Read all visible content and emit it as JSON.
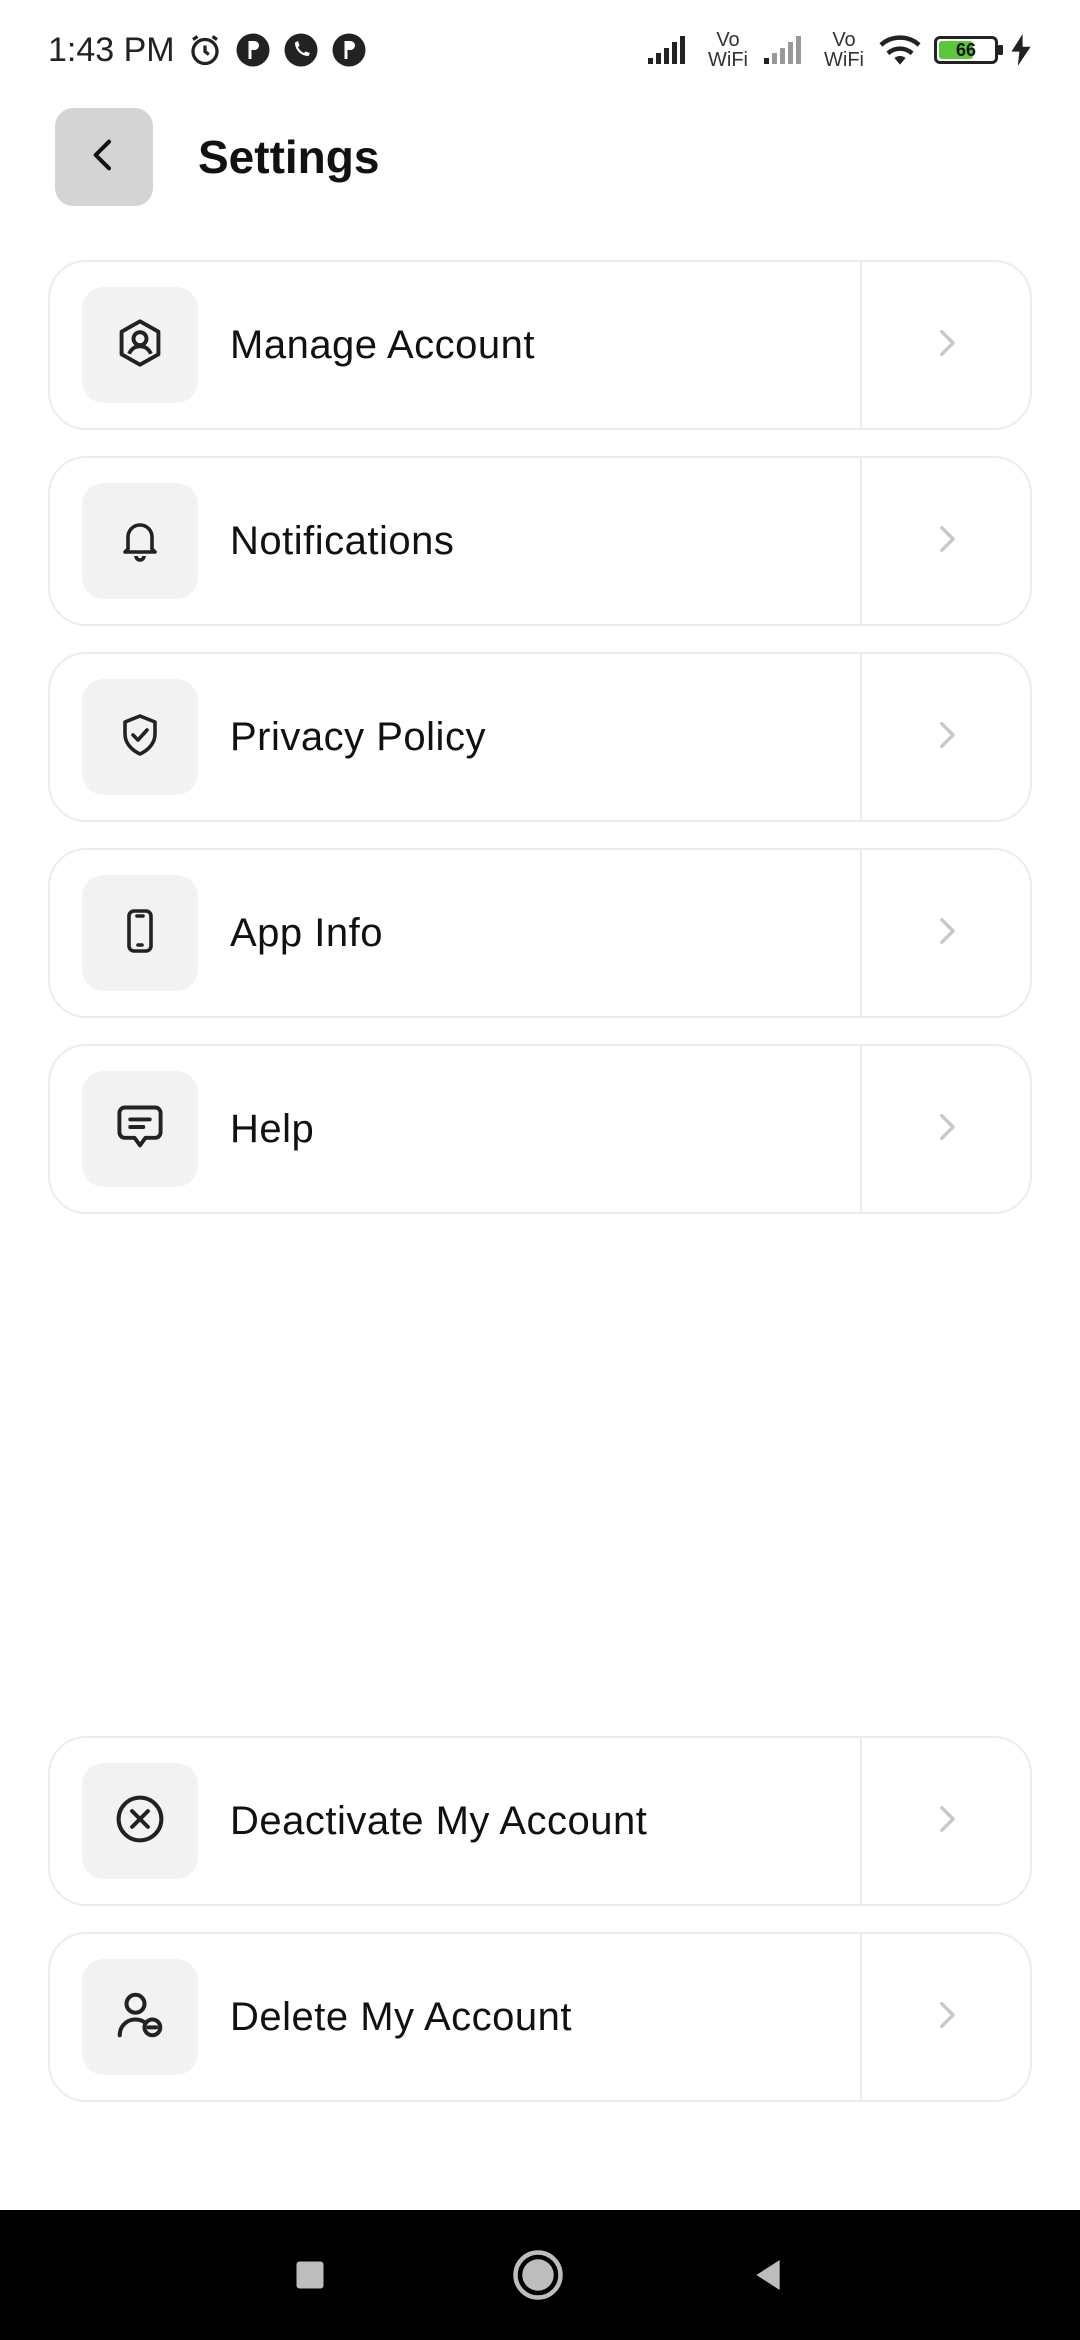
{
  "status_bar": {
    "time": "1:43 PM",
    "vowifi_1": "Vo WiFi",
    "vowifi_2": "Vo WiFi",
    "battery_level": "66",
    "battery_fraction": 0.66
  },
  "header": {
    "title": "Settings"
  },
  "settings": {
    "items": [
      {
        "label": "Manage Account",
        "icon": "user-shield-icon"
      },
      {
        "label": "Notifications",
        "icon": "bell-icon"
      },
      {
        "label": "Privacy Policy",
        "icon": "shield-check-icon"
      },
      {
        "label": "App Info",
        "icon": "phone-icon"
      },
      {
        "label": "Help",
        "icon": "message-icon"
      }
    ],
    "danger_items": [
      {
        "label": "Deactivate My Account",
        "icon": "x-circle-icon"
      },
      {
        "label": "Delete My Account",
        "icon": "user-minus-icon"
      }
    ]
  },
  "colors": {
    "background": "#ffffff",
    "back_button_bg": "#d4d4d4",
    "icon_box_bg": "#f2f2f2",
    "border": "#ececec",
    "battery_green": "#59c93a"
  }
}
